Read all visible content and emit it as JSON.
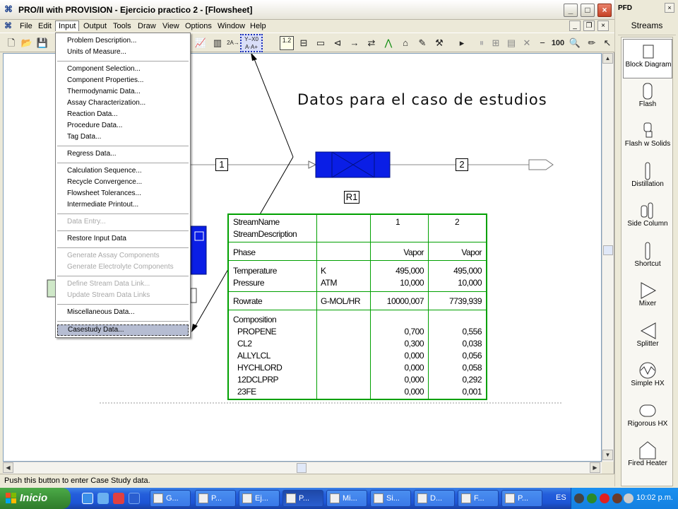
{
  "window": {
    "title": "PRO/II with PROVISION - Ejercicio practico 2 - [Flowsheet]",
    "app_icon": "pro2-app-icon"
  },
  "menubar": {
    "items": [
      {
        "label": "File"
      },
      {
        "label": "Edit"
      },
      {
        "label": "Input"
      },
      {
        "label": "Output"
      },
      {
        "label": "Tools"
      },
      {
        "label": "Draw"
      },
      {
        "label": "View"
      },
      {
        "label": "Options"
      },
      {
        "label": "Window"
      },
      {
        "label": "Help"
      }
    ],
    "active": "Input"
  },
  "toolbar": {
    "highlighted": "casestudy-data-button",
    "text_buttons": {
      "units": "2A→",
      "casestudy": "Y−X0\nA·A+",
      "sequence": "1.2",
      "zoom_100": "100"
    }
  },
  "input_menu": {
    "items": [
      {
        "label": "Problem Description...",
        "enabled": true
      },
      {
        "label": "Units of Measure...",
        "enabled": true
      },
      {
        "sep": true
      },
      {
        "label": "Component Selection...",
        "enabled": true
      },
      {
        "label": "Component Properties...",
        "enabled": true
      },
      {
        "label": "Thermodynamic Data...",
        "enabled": true
      },
      {
        "label": "Assay Characterization...",
        "enabled": true
      },
      {
        "label": "Reaction Data...",
        "enabled": true
      },
      {
        "label": "Procedure Data...",
        "enabled": true
      },
      {
        "label": "Tag Data...",
        "enabled": true
      },
      {
        "sep": true
      },
      {
        "label": "Regress Data...",
        "enabled": true
      },
      {
        "sep": true
      },
      {
        "label": "Calculation Sequence...",
        "enabled": true
      },
      {
        "label": "Recycle Convergence...",
        "enabled": true
      },
      {
        "label": "Flowsheet Tolerances...",
        "enabled": true
      },
      {
        "label": "Intermediate Printout...",
        "enabled": true
      },
      {
        "sep": true
      },
      {
        "label": "Data Entry...",
        "enabled": false
      },
      {
        "sep": true
      },
      {
        "label": "Restore Input Data",
        "enabled": true
      },
      {
        "sep": true
      },
      {
        "label": "Generate Assay Components",
        "enabled": false
      },
      {
        "label": "Generate Electrolyte Components",
        "enabled": false
      },
      {
        "sep": true
      },
      {
        "label": "Define Stream Data Link...",
        "enabled": false
      },
      {
        "label": "Update Stream Data Links",
        "enabled": false
      },
      {
        "sep": true
      },
      {
        "label": "Miscellaneous Data...",
        "enabled": true
      },
      {
        "sep": true
      },
      {
        "label": "Casestudy Data...",
        "enabled": true,
        "selected": true
      }
    ]
  },
  "flowsheet": {
    "annotation": "Datos para el caso de estudios",
    "stream_1_label": "1",
    "stream_2_label": "2",
    "unit_label": "R1",
    "unit_color": "#0a1ee6",
    "table_border_color": "#00a000",
    "stream_table": {
      "header_rows": [
        {
          "label": "StreamName",
          "unit": "",
          "s1": "1",
          "s2": "2"
        },
        {
          "label": "StreamDescription",
          "unit": "",
          "s1": "",
          "s2": ""
        }
      ],
      "phase": {
        "label": "Phase",
        "unit": "",
        "s1": "Vapor",
        "s2": "Vapor"
      },
      "conditions": [
        {
          "label": "Temperature",
          "unit": "K",
          "s1": "495,000",
          "s2": "495,000"
        },
        {
          "label": "Pressure",
          "unit": "ATM",
          "s1": "10,000",
          "s2": "10,000"
        }
      ],
      "rate": {
        "label": "Rowrate",
        "unit": "G-MOL/HR",
        "s1": "10000,007",
        "s2": "7739,939"
      },
      "composition_title": "Composition",
      "composition": [
        {
          "label": "PROPENE",
          "s1": "0,700",
          "s2": "0,556"
        },
        {
          "label": "CL2",
          "s1": "0,300",
          "s2": "0,038"
        },
        {
          "label": "ALLYLCL",
          "s1": "0,000",
          "s2": "0,056"
        },
        {
          "label": "HYCHLORD",
          "s1": "0,000",
          "s2": "0,058"
        },
        {
          "label": "12DCLPRP",
          "s1": "0,000",
          "s2": "0,292"
        },
        {
          "label": "23FE",
          "s1": "0,000",
          "s2": "0,001"
        }
      ]
    }
  },
  "status_bar": {
    "message": "Push this button to enter Case Study data."
  },
  "pfd_palette": {
    "title": "PFD",
    "close": "×",
    "streams_label": "Streams",
    "items": [
      {
        "label": "Block Diagram",
        "icon": "block-diagram-icon",
        "active": true
      },
      {
        "label": "Flash",
        "icon": "flash-icon"
      },
      {
        "label": "Flash w Solids",
        "icon": "flash-solids-icon"
      },
      {
        "label": "Distillation",
        "icon": "distillation-icon"
      },
      {
        "label": "Side Column",
        "icon": "side-column-icon"
      },
      {
        "label": "Shortcut",
        "icon": "shortcut-icon"
      },
      {
        "label": "Mixer",
        "icon": "mixer-icon"
      },
      {
        "label": "Splitter",
        "icon": "splitter-icon"
      },
      {
        "label": "Simple HX",
        "icon": "simple-hx-icon"
      },
      {
        "label": "Rigorous HX",
        "icon": "rigorous-hx-icon"
      },
      {
        "label": "Fired Heater",
        "icon": "fired-heater-icon"
      }
    ]
  },
  "taskbar": {
    "start_label": "Inicio",
    "tasks": [
      {
        "label": "G..."
      },
      {
        "label": "P..."
      },
      {
        "label": "Ej..."
      },
      {
        "label": "P...",
        "active": true
      },
      {
        "label": "Mi..."
      },
      {
        "label": "Si..."
      },
      {
        "label": "D..."
      },
      {
        "label": "F..."
      },
      {
        "label": "P..."
      }
    ],
    "language": "ES",
    "clock": "10:02 p.m."
  }
}
